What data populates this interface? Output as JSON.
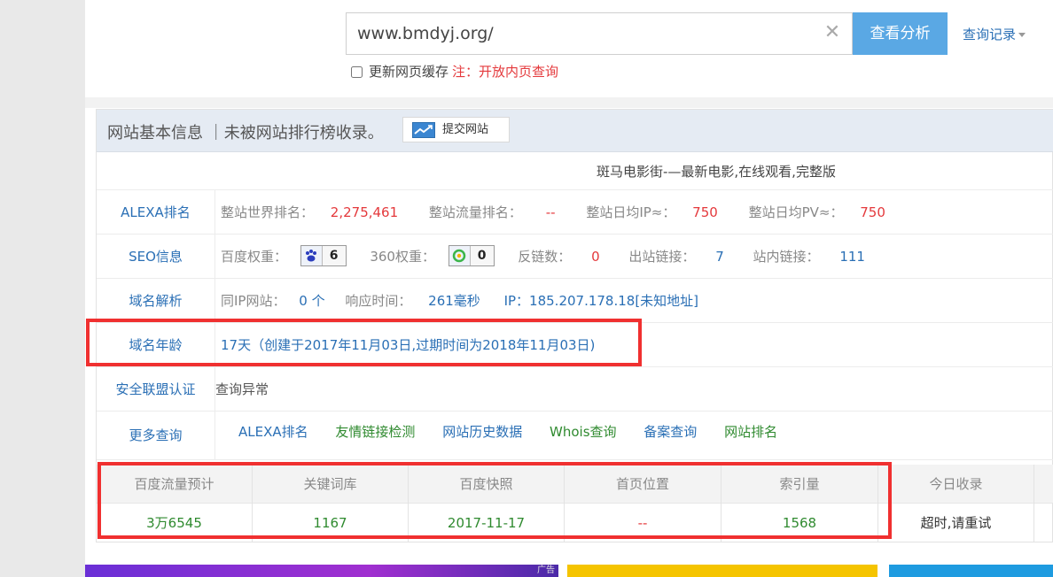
{
  "search": {
    "value": "www.bmdyj.org/",
    "clear_symbol": "✕",
    "submit_label": "查看分析",
    "history_label": "查询记录"
  },
  "refresh": {
    "label": "更新网页缓存",
    "note": "注：开放内页查询",
    "checked": false
  },
  "panel": {
    "title": "网站基本信息 ｜未被网站排行榜收录。",
    "submit_site_label": "提交网站",
    "site_title": "斑马电影街-—最新电影,在线观看,完整版"
  },
  "alexa": {
    "label": "ALEXA排名",
    "world_rank_label": "整站世界排名：",
    "world_rank": "2,275,461",
    "traffic_rank_label": "整站流量排名：",
    "traffic_rank": "--",
    "daily_ip_label": "整站日均IP≈：",
    "daily_ip": "750",
    "daily_pv_label": "整站日均PV≈：",
    "daily_pv": "750"
  },
  "seo": {
    "label": "SEO信息",
    "baidu_weight_label": "百度权重：",
    "baidu_weight": "6",
    "weight_360_label": "360权重：",
    "weight_360": "0",
    "backlinks_label": "反链数：",
    "backlinks": "0",
    "outbound_label": "出站链接：",
    "outbound": "7",
    "internal_label": "站内链接：",
    "internal": "111"
  },
  "dns": {
    "label": "域名解析",
    "same_ip_label": "同IP网站：",
    "same_ip": "0 个",
    "response_label": "响应时间：",
    "response": "261毫秒",
    "ip_text": "IP：185.207.178.18[未知地址]"
  },
  "domain_age": {
    "label": "域名年龄",
    "text": "17天（创建于2017年11月03日,过期时间为2018年11月03日)"
  },
  "security": {
    "label": "安全联盟认证",
    "text": "查询异常"
  },
  "more": {
    "label": "更多查询",
    "links": [
      "ALEXA排名",
      "友情链接检测",
      "网站历史数据",
      "Whois查询",
      "备案查询",
      "网站排名"
    ]
  },
  "stats": {
    "headers": [
      "百度流量预计",
      "关键词库",
      "百度快照",
      "首页位置",
      "索引量",
      "今日收录"
    ],
    "values": [
      "3万6545",
      "1167",
      "2017-11-17",
      "--",
      "1568",
      "超时,请重试"
    ]
  },
  "colors": {
    "accent": "#5aa8e4",
    "link": "#2a6fb5",
    "red": "#e4393c",
    "green": "#2f8a2f",
    "highlight": "#f03030"
  },
  "ads": {
    "ad_tag": "广告"
  }
}
